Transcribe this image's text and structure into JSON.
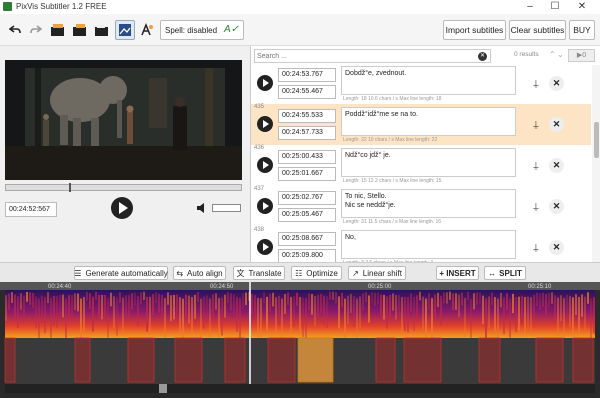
{
  "app": {
    "title": "PixVis Subtitler 1.2 FREE"
  },
  "toolbar": {
    "spell_label": "Spell: disabled",
    "import_label": "Import subtitles",
    "clear_label": "Clear subtitles",
    "buy_label": "BUY"
  },
  "player": {
    "time": "00:24:52:567",
    "position": 0.27,
    "volume": 1.0
  },
  "search": {
    "placeholder": "Search ...",
    "results": "0 results"
  },
  "subtitles": [
    {
      "num": "",
      "start": "00:24:53.767",
      "end": "00:24:55.467",
      "text": "Dobdž°e, zvednout.",
      "meta": "Length: 18    10.6 chars / s    Max line length: 18",
      "selected": false
    },
    {
      "num": "435",
      "start": "00:24:55.533",
      "end": "00:24:57.733",
      "text": "Poddž°idž°me se na to.",
      "meta": "Length: 22    10 chars / s    Max line length: 22",
      "selected": true
    },
    {
      "num": "436",
      "start": "00:25:00.433",
      "end": "00:25:01.667",
      "text": "Ndž°co jdž° je.",
      "meta": "Length: 15    12.2 chars / s    Max line length: 15",
      "selected": false
    },
    {
      "num": "437",
      "start": "00:25:02.767",
      "end": "00:25:05.467",
      "text": "To nic, Stello.\nNic se neddž°je.",
      "meta": "Length: 31    11.5 chars / s    Max line length: 16",
      "selected": false
    },
    {
      "num": "438",
      "start": "00:25:08.667",
      "end": "00:25:09.800",
      "text": "No,",
      "meta": "Length: 3    2.6 chars / s    Max line length: 3",
      "selected": false
    }
  ],
  "editbar": {
    "generate": "Generate automatically",
    "autoalign": "Auto align",
    "translate": "Translate",
    "optimize": "Optimize",
    "linear": "Linear shift",
    "insert": "+ INSERT",
    "split": "SPLIT"
  },
  "timeline": {
    "ticks": [
      "00:24:40",
      "00:24:50",
      "00:25:00",
      "00:25:10"
    ]
  },
  "colors": {
    "accent": "#f2a03c",
    "selected_row": "#fde4c4",
    "segment": "#a22a2a"
  }
}
